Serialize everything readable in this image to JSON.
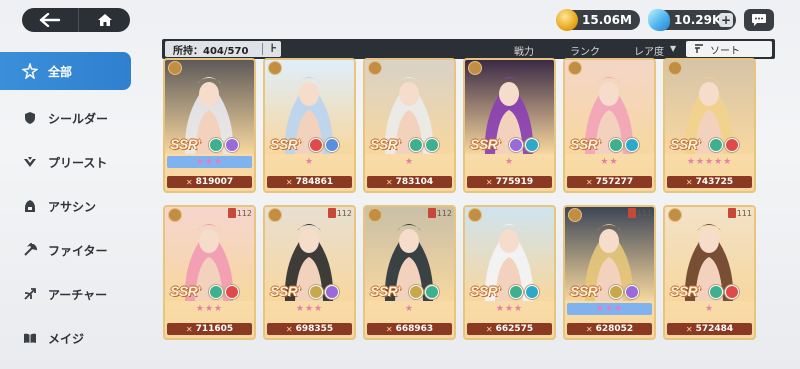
{
  "topbar": {
    "gold": "15.06M",
    "gems": "10.29K",
    "gem_plus": "+"
  },
  "sidebar": {
    "items": [
      {
        "label": "全部",
        "icon": "star-burst-icon",
        "active": true
      },
      {
        "label": "シールダー",
        "icon": "shield-icon"
      },
      {
        "label": "プリースト",
        "icon": "wings-icon"
      },
      {
        "label": "アサシン",
        "icon": "hood-icon"
      },
      {
        "label": "ファイター",
        "icon": "axe-icon"
      },
      {
        "label": "アーチャー",
        "icon": "bow-icon"
      },
      {
        "label": "メイジ",
        "icon": "book-icon"
      }
    ]
  },
  "filter": {
    "owned_label": "所持：404/570",
    "pin": "⊦",
    "power_label": "戦力",
    "rank_label": "ランク",
    "rarity_label": "レア度",
    "sort_label": "ソート"
  },
  "cards": [
    {
      "power": "819007",
      "stars": "★★★",
      "star_style": "blue",
      "level": "",
      "hair": "#e9e9ee",
      "bg": "#5e5a5a",
      "badges": [
        "#3fb08f",
        "#9a6bd8"
      ]
    },
    {
      "power": "784861",
      "stars": "★",
      "star_style": "plain",
      "level": "",
      "hair": "#b9d4ef",
      "bg": "#dfeefb",
      "badges": [
        "#e04a4a",
        "#5a8fe0"
      ]
    },
    {
      "power": "783104",
      "stars": "★",
      "star_style": "plain",
      "level": "",
      "hair": "#ececec",
      "bg": "#d9d2c8",
      "badges": [
        "#3fb08f",
        "#3fb08f"
      ]
    },
    {
      "power": "775919",
      "stars": "★",
      "star_style": "plain",
      "level": "",
      "hair": "#8a3fb5",
      "bg": "#3b2a46",
      "badges": [
        "#9a6bd8",
        "#2fa8c8"
      ]
    },
    {
      "power": "757277",
      "stars": "★★",
      "star_style": "plain",
      "level": "",
      "hair": "#f3a3b9",
      "bg": "#f4d6c8",
      "badges": [
        "#3fb08f",
        "#2fa8c8"
      ]
    },
    {
      "power": "743725",
      "stars": "★★★★★",
      "star_style": "plain",
      "level": "",
      "hair": "#f1d38c",
      "bg": "#d6c4a8",
      "badges": [
        "#3fb08f",
        "#e04a4a"
      ]
    },
    {
      "power": "711605",
      "stars": "★★★",
      "star_style": "plain",
      "level": "112",
      "hair": "#f19ab2",
      "bg": "#f6d5cf",
      "badges": [
        "#3fb08f",
        "#e04a4a"
      ]
    },
    {
      "power": "698355",
      "stars": "★★★",
      "star_style": "plain",
      "level": "112",
      "hair": "#2a2a2a",
      "bg": "#e8dfd2",
      "badges": [
        "#c8a84a",
        "#9a6bd8"
      ]
    },
    {
      "power": "668963",
      "stars": "★",
      "star_style": "plain",
      "level": "112",
      "hair": "#27323a",
      "bg": "#c9bfa8",
      "badges": [
        "#c8a84a",
        "#3fb08f"
      ]
    },
    {
      "power": "662575",
      "stars": "★★★",
      "star_style": "plain",
      "level": "",
      "hair": "#f4f4f8",
      "bg": "#cfe3ef",
      "badges": [
        "#3fb08f",
        "#2fa8c8"
      ]
    },
    {
      "power": "628052",
      "stars": "★★★",
      "star_style": "blue",
      "level": "111",
      "hair": "#e6c77a",
      "bg": "#3d4656",
      "badges": [
        "#c8a84a",
        "#9a6bd8"
      ]
    },
    {
      "power": "572484",
      "stars": "★",
      "star_style": "plain",
      "level": "111",
      "hair": "#6a3f27",
      "bg": "#f2e2c8",
      "badges": [
        "#3fb08f",
        "#e04a4a"
      ]
    }
  ],
  "colors": {
    "accent": "#2f80cf",
    "dark_bar": "#2b3037",
    "power_bar": "#8a3a22"
  }
}
